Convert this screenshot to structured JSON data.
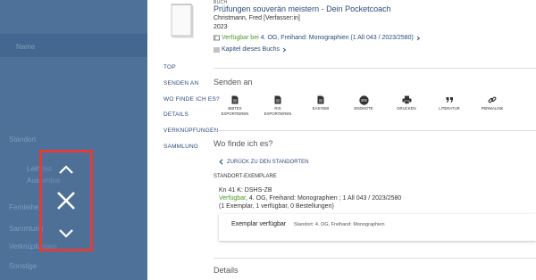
{
  "backdrop": {
    "texts": [
      "Name",
      "Standort",
      "Leihfrist",
      "Ausleihbar",
      "Fernleihe",
      "Sammlung",
      "Verknüpfungen",
      "Sonstige"
    ]
  },
  "nav": {
    "up_icon": "chevron-up-icon",
    "close_icon": "close-icon",
    "down_icon": "chevron-down-icon"
  },
  "record": {
    "type": "BUCH",
    "title": "Prüfungen souverän meistern - Dein Pocketcoach",
    "author": "Christmann, Fred [Verfasser:in]",
    "year": "2023",
    "availability_status": "Verfügbar bei",
    "availability_location": "4. OG, Freihand: Monographien (1 All 043 / 2023/2580)",
    "chapter_link": "Kapitel dieses Buchs"
  },
  "sidenav": [
    "TOP",
    "SENDEN AN",
    "WO FINDE ICH ES?",
    "DETAILS",
    "VERKNÜPFUNGEN",
    "SAMMLUNG"
  ],
  "send": {
    "title": "Senden an",
    "actions": [
      {
        "label": "BIBTEX\nEXPORTIEREN",
        "icon": "file-icon"
      },
      {
        "label": "RIS\nEXPORTIEREN",
        "icon": "file-icon"
      },
      {
        "label": "EASYBIB",
        "icon": "file-icon"
      },
      {
        "label": "ENDNOTE",
        "icon": "endnote-icon"
      },
      {
        "label": "DRUCKEN",
        "icon": "printer-icon"
      },
      {
        "label": "LITERATUR",
        "icon": "quote-icon"
      },
      {
        "label": "PERMALINK",
        "icon": "link-icon"
      }
    ]
  },
  "location": {
    "title": "Wo finde ich es?",
    "back_label": "ZURÜCK ZU DEN STANDORTEN",
    "standort_label": "STANDORT-EXEMPLARE",
    "holding_name": "Kn 41 K: DSHS-ZB",
    "holding_status": "Verfügbar",
    "holding_detail": ", 4. OG, Freihand: Monographien ; 1 All 043 / 2023/2580",
    "holding_counts": "(1 Exemplar, 1 verfügbar, 0 Bestellungen)",
    "item_status": "Exemplar verfügbar",
    "item_location": "Standort: 4. OG, Freihand: Monographien"
  },
  "details": {
    "title": "Details"
  },
  "colors": {
    "link": "#2c4a7a",
    "available": "#4a9a2a",
    "nav_border": "#e03c3c"
  }
}
